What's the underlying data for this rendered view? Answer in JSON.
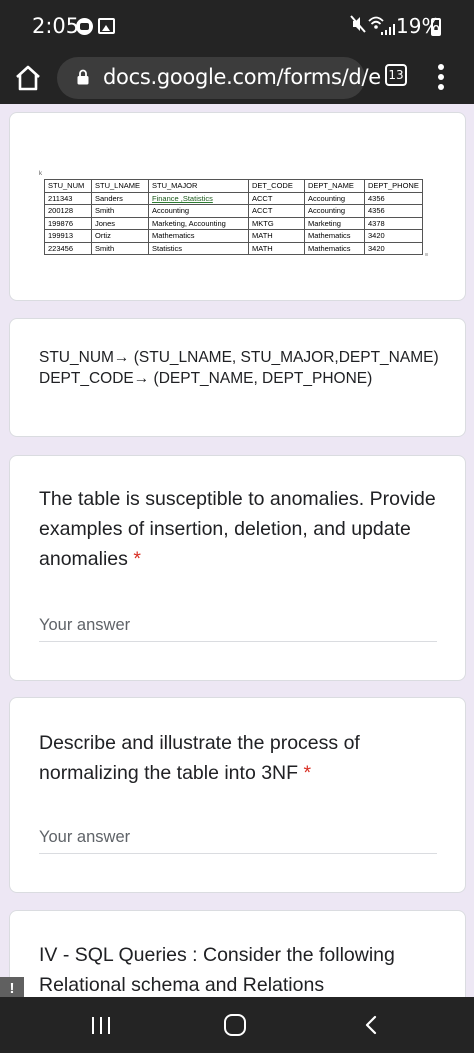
{
  "status_bar": {
    "time": "2:05",
    "battery": "19%",
    "icons": [
      "messenger-icon",
      "gallery-icon",
      "mute-icon",
      "wifi-icon",
      "signal-icon",
      "battery-icon"
    ]
  },
  "browser": {
    "url": "docs.google.com/forms/d/e",
    "tab_count": "13",
    "icons": [
      "home-icon",
      "lock-icon",
      "tabs-icon",
      "menu-icon"
    ]
  },
  "relation_table": {
    "headers": [
      "STU_NUM",
      "STU_LNAME",
      "STU_MAJOR",
      "DET_CODE",
      "DEPT_NAME",
      "DEPT_PHONE"
    ],
    "rows": [
      [
        "211343",
        "Sanders",
        "Finance ,Statistics",
        "ACCT",
        "Accounting",
        "4356"
      ],
      [
        "200128",
        "Smith",
        "Accounting",
        "ACCT",
        "Accounting",
        "4356"
      ],
      [
        "199876",
        "Jones",
        "Marketing, Accounting",
        "MKTG",
        "Marketing",
        "4378"
      ],
      [
        "199913",
        "Ortiz",
        "Mathematics",
        "MATH",
        "Mathematics",
        "3420"
      ],
      [
        "223456",
        "Smith",
        "Statistics",
        "MATH",
        "Mathematics",
        "3420"
      ]
    ]
  },
  "dependencies": {
    "line1": "STU_NUM→ (STU_LNAME, STU_MAJOR,DEPT_NAME)",
    "line2": "DEPT_CODE→ (DEPT_NAME, DEPT_PHONE)"
  },
  "question1": {
    "title": "The table is susceptible to anomalies. Provide examples of insertion, deletion, and update anomalies",
    "required_mark": "*",
    "placeholder": "Your answer"
  },
  "question2": {
    "title": "Describe and illustrate the process of normalizing the table into 3NF",
    "required_mark": "*",
    "placeholder": "Your answer"
  },
  "section": {
    "title": "IV - SQL Queries : Consider the following Relational schema and Relations"
  },
  "alert_badge": "!",
  "colors": {
    "page_background": "#ede7f4",
    "system_bar": "#242424",
    "required": "#d93025"
  }
}
